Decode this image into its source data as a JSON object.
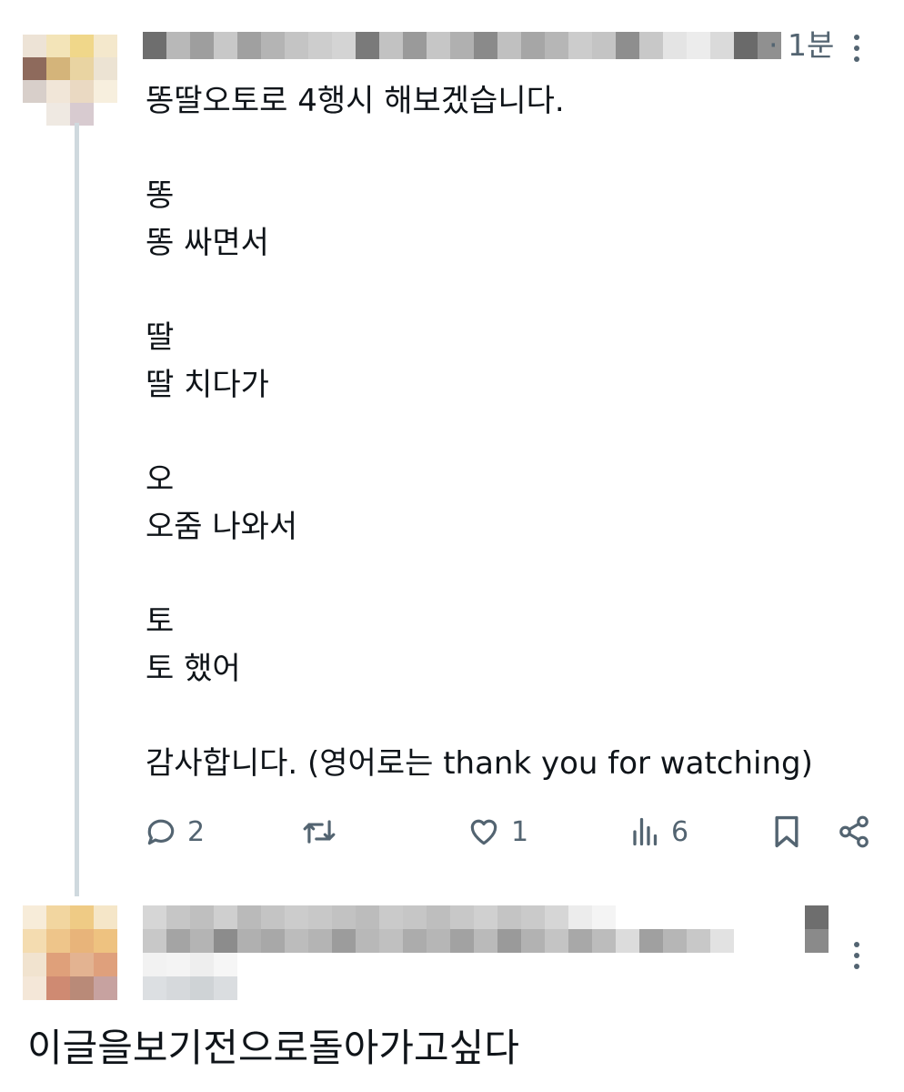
{
  "post": {
    "timestamp": "· 1분",
    "lines": [
      "똥딸오토로 4행시 해보겠습니다.",
      "",
      "똥",
      "똥 싸면서",
      "",
      "딸",
      "딸 치다가",
      "",
      "오",
      "오줌 나와서",
      "",
      "토",
      "토 했어",
      "",
      "감사합니다. (영어로는 thank you for watching)"
    ],
    "actions": {
      "reply_count": "2",
      "like_count": "1",
      "views_count": "6"
    },
    "icons": [
      "reply-icon",
      "retweet-icon",
      "like-icon",
      "views-icon",
      "bookmark-icon",
      "share-icon",
      "more-icon"
    ]
  },
  "reply": {
    "text": "이글을보기전으로돌아가고싶다"
  },
  "colors": {
    "text": "#0f1419",
    "secondary": "#536471",
    "thread_line": "#cfd9de"
  }
}
